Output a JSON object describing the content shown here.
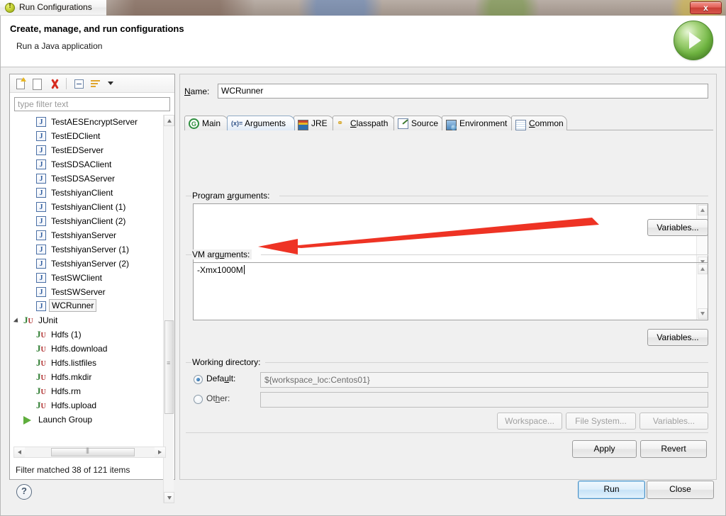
{
  "window": {
    "title": "Run Configurations",
    "title_icon": "run-config-icon",
    "close_label": "x"
  },
  "header": {
    "title": "Create, manage, and run configurations",
    "subtitle": "Run a Java application",
    "badge_icon": "green-run-play-icon"
  },
  "left_panel": {
    "toolbar": [
      {
        "name": "new-configuration-icon",
        "tooltip": "New launch configuration"
      },
      {
        "name": "duplicate-configuration-icon",
        "tooltip": "Duplicate"
      },
      {
        "name": "delete-configuration-icon",
        "tooltip": "Delete"
      },
      {
        "name": "collapse-all-icon",
        "tooltip": "Collapse All"
      },
      {
        "name": "filter-icon",
        "tooltip": "Filter"
      },
      {
        "name": "chevron-down-icon",
        "tooltip": "Menu"
      }
    ],
    "filter_placeholder": "type filter text",
    "filter_value": "",
    "status": "Filter matched 38 of 121 items",
    "tree": [
      {
        "label": "TestAESEncryptServer",
        "icon": "java-application-icon",
        "indent": 1,
        "selected": false,
        "expandable": false
      },
      {
        "label": "TestEDClient",
        "icon": "java-application-icon",
        "indent": 1,
        "selected": false,
        "expandable": false
      },
      {
        "label": "TestEDServer",
        "icon": "java-application-icon",
        "indent": 1,
        "selected": false,
        "expandable": false
      },
      {
        "label": "TestSDSAClient",
        "icon": "java-application-icon",
        "indent": 1,
        "selected": false,
        "expandable": false
      },
      {
        "label": "TestSDSAServer",
        "icon": "java-application-icon",
        "indent": 1,
        "selected": false,
        "expandable": false
      },
      {
        "label": "TestshiyanClient",
        "icon": "java-application-icon",
        "indent": 1,
        "selected": false,
        "expandable": false
      },
      {
        "label": "TestshiyanClient (1)",
        "icon": "java-application-icon",
        "indent": 1,
        "selected": false,
        "expandable": false
      },
      {
        "label": "TestshiyanClient (2)",
        "icon": "java-application-icon",
        "indent": 1,
        "selected": false,
        "expandable": false
      },
      {
        "label": "TestshiyanServer",
        "icon": "java-application-icon",
        "indent": 1,
        "selected": false,
        "expandable": false
      },
      {
        "label": "TestshiyanServer (1)",
        "icon": "java-application-icon",
        "indent": 1,
        "selected": false,
        "expandable": false
      },
      {
        "label": "TestshiyanServer (2)",
        "icon": "java-application-icon",
        "indent": 1,
        "selected": false,
        "expandable": false
      },
      {
        "label": "TestSWClient",
        "icon": "java-application-icon",
        "indent": 1,
        "selected": false,
        "expandable": false
      },
      {
        "label": "TestSWServer",
        "icon": "java-application-icon",
        "indent": 1,
        "selected": false,
        "expandable": false
      },
      {
        "label": "WCRunner",
        "icon": "java-application-icon",
        "indent": 1,
        "selected": true,
        "expandable": false
      },
      {
        "label": "JUnit",
        "icon": "junit-icon",
        "indent": 0,
        "selected": false,
        "expandable": true
      },
      {
        "label": "Hdfs (1)",
        "icon": "junit-icon",
        "indent": 1,
        "selected": false,
        "expandable": false
      },
      {
        "label": "Hdfs.download",
        "icon": "junit-icon",
        "indent": 1,
        "selected": false,
        "expandable": false
      },
      {
        "label": "Hdfs.listfiles",
        "icon": "junit-icon",
        "indent": 1,
        "selected": false,
        "expandable": false
      },
      {
        "label": "Hdfs.mkdir",
        "icon": "junit-icon",
        "indent": 1,
        "selected": false,
        "expandable": false
      },
      {
        "label": "Hdfs.rm",
        "icon": "junit-icon",
        "indent": 1,
        "selected": false,
        "expandable": false
      },
      {
        "label": "Hdfs.upload",
        "icon": "junit-icon",
        "indent": 1,
        "selected": false,
        "expandable": false
      },
      {
        "label": "Launch Group",
        "icon": "launch-group-icon",
        "indent": 0,
        "selected": false,
        "expandable": false
      }
    ]
  },
  "right_panel": {
    "name_label": "Name:",
    "name_value": "WCRunner",
    "tabs": [
      {
        "label": "Main",
        "icon": "main-tab-icon",
        "active": false
      },
      {
        "label": "Arguments",
        "icon": "arguments-tab-icon",
        "active": true
      },
      {
        "label": "JRE",
        "icon": "jre-tab-icon",
        "active": false
      },
      {
        "label": "Classpath",
        "icon": "classpath-tab-icon",
        "active": false
      },
      {
        "label": "Source",
        "icon": "source-tab-icon",
        "active": false
      },
      {
        "label": "Environment",
        "icon": "environment-tab-icon",
        "active": false
      },
      {
        "label": "Common",
        "icon": "common-tab-icon",
        "active": false
      }
    ],
    "program_arguments": {
      "label": "Program arguments:",
      "value": "",
      "variables_button": "Variables..."
    },
    "vm_arguments": {
      "label": "VM arguments:",
      "value": "-Xmx1000M",
      "variables_button": "Variables..."
    },
    "working_directory": {
      "label": "Working directory:",
      "default_label": "Default:",
      "default_value": "${workspace_loc:Centos01}",
      "default_selected": true,
      "other_label": "Other:",
      "other_value": "",
      "other_selected": false,
      "workspace_button": "Workspace...",
      "file_system_button": "File System...",
      "variables_button": "Variables..."
    },
    "apply_button": "Apply",
    "revert_button": "Revert"
  },
  "footer": {
    "help_icon": "help-question-icon",
    "run_button": "Run",
    "close_button": "Close"
  },
  "annotation": {
    "arrow_color": "#ee3324",
    "points_to": "vm-arguments-textarea"
  }
}
